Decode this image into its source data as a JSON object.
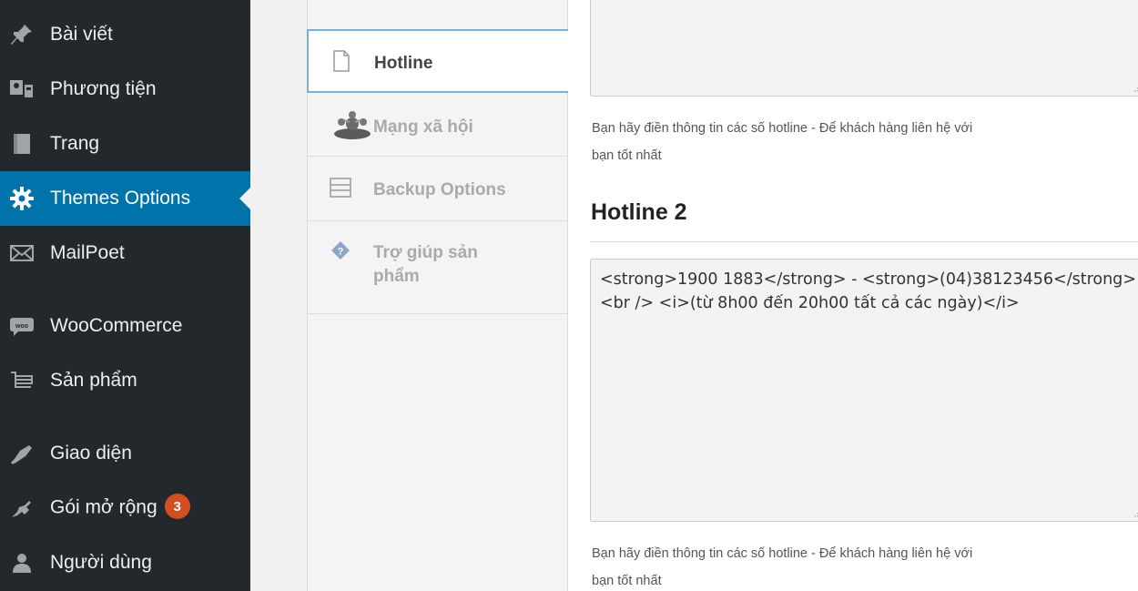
{
  "sidebar": {
    "items": [
      {
        "label": "Bài viết",
        "icon": "pin-icon"
      },
      {
        "label": "Phương tiện",
        "icon": "media-icon"
      },
      {
        "label": "Trang",
        "icon": "page-icon"
      },
      {
        "label": "Themes Options",
        "icon": "gear-icon",
        "active": true
      },
      {
        "label": "MailPoet",
        "icon": "envelope-icon"
      },
      {
        "label": "WooCommerce",
        "icon": "woo-icon"
      },
      {
        "label": "Sản phẩm",
        "icon": "cart-icon"
      },
      {
        "label": "Giao diện",
        "icon": "brush-icon"
      },
      {
        "label": "Gói mở rộng",
        "icon": "plugin-icon",
        "badge": "3"
      },
      {
        "label": "Người dùng",
        "icon": "user-icon"
      }
    ]
  },
  "options_nav": {
    "tabs": [
      {
        "label": "Hotline",
        "icon": "document-icon",
        "current": true
      },
      {
        "label": "Mạng xã hội",
        "icon": "social-icon"
      },
      {
        "label": "Backup Options",
        "icon": "backup-icon"
      },
      {
        "label": "Trợ giúp sản phẩm",
        "icon": "help-icon"
      }
    ]
  },
  "content": {
    "hotline1_description": "Bạn hãy điền thông tin các số hotline - Để khách hàng liên hệ với bạn tốt nhất",
    "hotline2_title": "Hotline 2",
    "hotline2_value": "<strong>1900 1883</strong> - <strong>(04)38123456</strong> <br /> <i>(từ 8h00 đến 20h00 tất cả các ngày)</i>",
    "hotline2_description": "Bạn hãy điền thông tin các số hotline - Để khách hàng liên hệ với bạn tốt nhất"
  },
  "colors": {
    "sidebar_bg": "#23282d",
    "active_bg": "#0073aa",
    "badge_bg": "#d54e21",
    "current_tab_border": "#7aaedc"
  }
}
